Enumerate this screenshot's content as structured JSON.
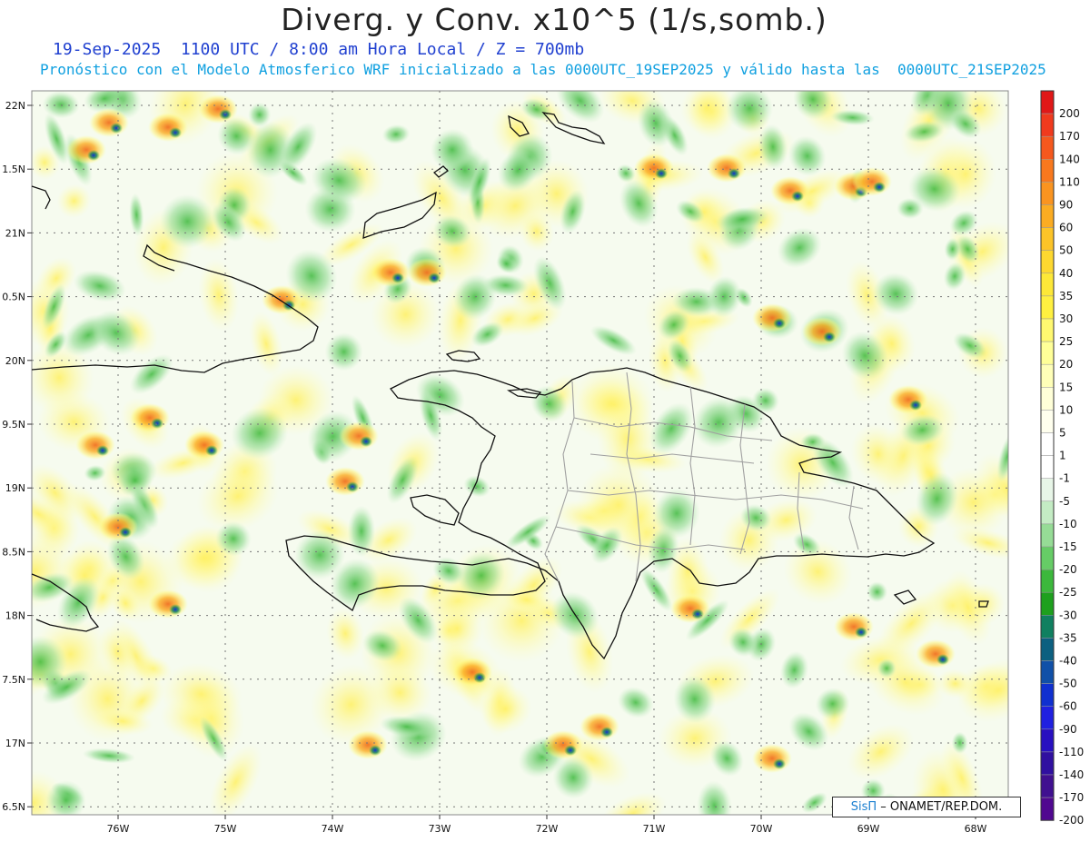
{
  "header": {
    "title": "Diverg. y Conv. x10^5 (1/s,somb.)",
    "subtitle_time": "19-Sep-2025  1100 UTC / 8:00 am Hora Local / Z = 700mb",
    "subtitle_model": "Pronóstico con el Modelo Atmosferico WRF inicializado a las 0000UTC_19SEP2025 y válido hasta las  0000UTC_21SEP2025"
  },
  "axes": {
    "lat_labels": [
      "22N",
      "1.5N",
      "21N",
      "0.5N",
      "20N",
      "9.5N",
      "19N",
      "8.5N",
      "18N",
      "7.5N",
      "17N",
      "6.5N"
    ],
    "lon_labels": [
      "76W",
      "75W",
      "74W",
      "73W",
      "72W",
      "71W",
      "70W",
      "69W",
      "68W"
    ]
  },
  "colorbar": {
    "labels": [
      "200",
      "170",
      "140",
      "110",
      "90",
      "60",
      "50",
      "40",
      "35",
      "30",
      "25",
      "20",
      "15",
      "10",
      "5",
      "1",
      "-1",
      "-5",
      "-10",
      "-15",
      "-20",
      "-25",
      "-30",
      "-35",
      "-40",
      "-50",
      "-60",
      "-90",
      "-110",
      "-140",
      "-170",
      "-200"
    ],
    "colors": [
      "#e01818",
      "#f03a1e",
      "#f5581e",
      "#f8781e",
      "#fa9420",
      "#fbac22",
      "#fcc428",
      "#fdd830",
      "#fde838",
      "#fff040",
      "#fff870",
      "#ffff98",
      "#ffffb8",
      "#ffffd8",
      "#ffffee",
      "#ffffff",
      "#ffffff",
      "#e8f6e8",
      "#c4ecc4",
      "#96dc96",
      "#66cc66",
      "#3cb83c",
      "#1ea01e",
      "#108060",
      "#0c6080",
      "#1050a8",
      "#1030d0",
      "#2020e0",
      "#2810c0",
      "#3010a0",
      "#401090",
      "#500890"
    ]
  },
  "credit": {
    "logo": "SisΠ",
    "text": "– ONAMET/REP.DOM."
  }
}
